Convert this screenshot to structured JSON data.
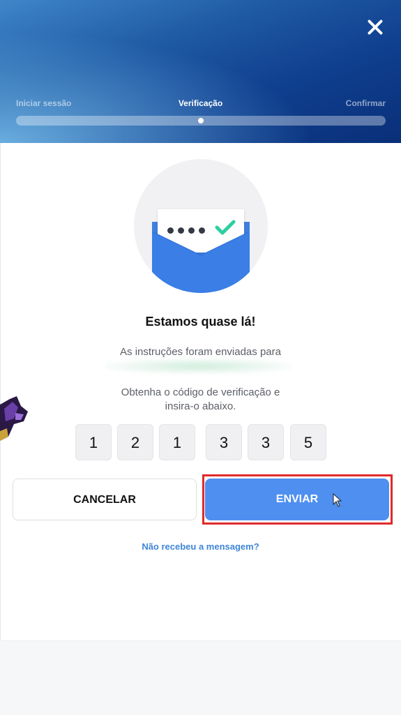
{
  "header": {
    "close_icon": "close-icon",
    "steps": [
      "Iniciar sessão",
      "Verificação",
      "Confirmar"
    ],
    "active_step": 1,
    "progress": 0.5
  },
  "main": {
    "illustration_icon": "envelope-check-icon",
    "title": "Estamos quase lá!",
    "instructions": "As instruções foram enviadas para",
    "code_prompt_line1": "Obtenha o código de verificação e",
    "code_prompt_line2": "insira-o abaixo.",
    "code_digits": [
      "1",
      "2",
      "1",
      "3",
      "3",
      "5"
    ]
  },
  "actions": {
    "cancel_label": "CANCELAR",
    "send_label": "ENVIAR",
    "resend_link": "Não recebeu a mensagem?"
  },
  "colors": {
    "accent": "#4f8ff0",
    "link": "#3f86d8",
    "highlight": "#e02a2a",
    "check": "#2ccfa0"
  }
}
